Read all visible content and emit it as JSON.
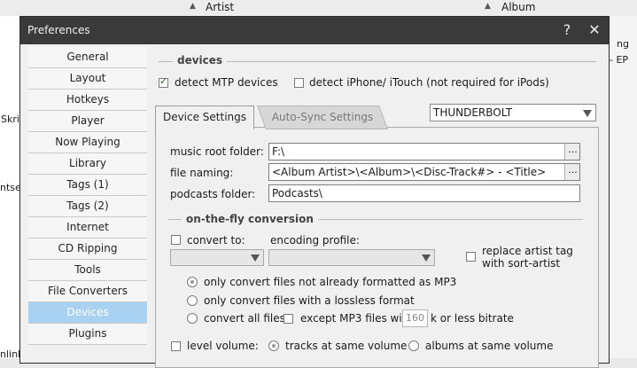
{
  "background": {
    "columns": [
      "Artist",
      "Album"
    ],
    "left_fragments": [
      "Skri",
      "ntser",
      "nlink"
    ],
    "right_fragments": [
      "ng",
      "- EP"
    ]
  },
  "window": {
    "title": "Preferences",
    "help_glyph": "?",
    "close_glyph": "✕"
  },
  "nav": {
    "items": [
      "General",
      "Layout",
      "Hotkeys",
      "Player",
      "Now Playing",
      "Library",
      "Tags (1)",
      "Tags (2)",
      "Internet",
      "CD Ripping",
      "Tools",
      "File Converters",
      "Devices",
      "Plugins"
    ],
    "selected": "Devices"
  },
  "devices": {
    "group_label": "devices",
    "detect_mtp_label": "detect MTP devices",
    "detect_mtp_checked": true,
    "detect_iphone_label": "detect iPhone/ iTouch (not required for iPods)",
    "detect_iphone_checked": false
  },
  "tabs": [
    "Device Settings",
    "Auto-Sync Settings"
  ],
  "device_select": {
    "value": "THUNDERBOLT"
  },
  "settings": {
    "music_root_label": "music root folder:",
    "music_root_value": "F:\\",
    "file_naming_label": "file naming:",
    "file_naming_value": "<Album Artist>\\<Album>\\<Disc-Track#> - <Title>",
    "podcasts_label": "podcasts folder:",
    "podcasts_value": "Podcasts\\",
    "browse_label": "..."
  },
  "conversion": {
    "group_label": "on-the-fly conversion",
    "convert_to_label": "convert to:",
    "encoding_profile_label": "encoding profile:",
    "replace_artist_label_1": "replace artist tag",
    "replace_artist_label_2": "with sort-artist",
    "radio_1": "only convert files not already formatted as MP3",
    "radio_2": "only convert files with a lossless format",
    "radio_3": "convert all files",
    "except_label": "except MP3 files with",
    "bitrate_value": "160",
    "bitrate_suffix": "k or less bitrate",
    "selected_option": 1
  },
  "level_volume": {
    "label": "level volume:",
    "option_tracks": "tracks at same volume",
    "option_albums": "albums at same volume",
    "selected_option": 1
  }
}
